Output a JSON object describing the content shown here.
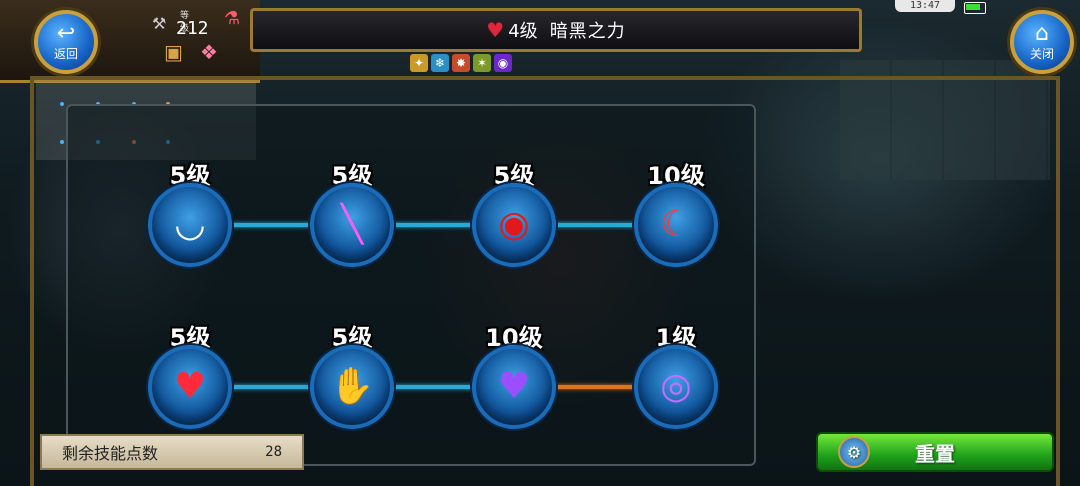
{
  "header": {
    "title_level": "4级",
    "title_name": "暗黑之力",
    "back_label": "返回",
    "close_label": "关闭",
    "player_level_label": "等级",
    "player_level": "212",
    "clock": "13:47"
  },
  "skills": [
    {
      "name": "fang-bite-skill",
      "level": "5级",
      "glyph": "◡",
      "color": "#ffffff"
    },
    {
      "name": "slash-skill",
      "level": "5级",
      "glyph": "╲",
      "color": "#ff5cf2"
    },
    {
      "name": "bleeding-eye-skill",
      "level": "5级",
      "glyph": "◉",
      "color": "#e01a1a"
    },
    {
      "name": "blood-claw-skill",
      "level": "10级",
      "glyph": "☾",
      "color": "#ff3535"
    },
    {
      "name": "bleeding-heart-skill",
      "level": "5级",
      "glyph": "♥",
      "color": "#ff2a3a"
    },
    {
      "name": "demon-hand-skill",
      "level": "5级",
      "glyph": "✋",
      "color": "#ff5151"
    },
    {
      "name": "purple-heart-skill",
      "level": "10级",
      "glyph": "♥",
      "color": "#9b4dff"
    },
    {
      "name": "dark-eye-skill",
      "level": "1级",
      "glyph": "◎",
      "color": "#c86bff"
    }
  ],
  "bottom": {
    "points_label": "剩余技能点数",
    "points_value": "28",
    "reset_label": "重置"
  }
}
